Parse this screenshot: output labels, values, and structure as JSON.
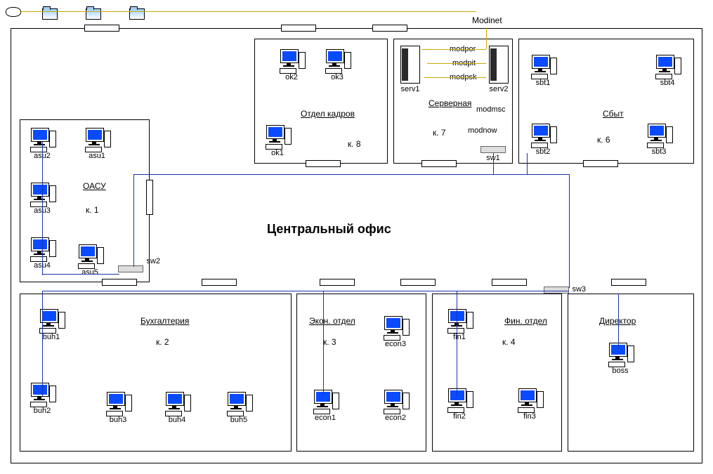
{
  "title": "Центральный офис",
  "modinet_label": "Modinet",
  "rooms": {
    "oasu": {
      "title": "ОАСУ",
      "room": "к. 1"
    },
    "buh": {
      "title": "Бухгалтерия",
      "room": "к. 2"
    },
    "econ": {
      "title": "Экон. отдел",
      "room": "к. 3"
    },
    "fin": {
      "title": "Фин. отдел",
      "room": "к. 4"
    },
    "dir": {
      "title": "Директор"
    },
    "hr": {
      "title": "Отдел кадров",
      "room": "к. 8"
    },
    "srvr": {
      "title": "Серверная",
      "room": "к. 7"
    },
    "sbyt": {
      "title": "Сбыт",
      "room": "к. 6"
    }
  },
  "pcs": {
    "asu1": "asu1",
    "asu2": "asu2",
    "asu3": "asu3",
    "asu4": "asu4",
    "asu5": "asu5",
    "buh1": "buh1",
    "buh2": "buh2",
    "buh3": "buh3",
    "buh4": "buh4",
    "buh5": "buh5",
    "econ1": "econ1",
    "econ2": "econ2",
    "econ3": "econ3",
    "fin1": "fin1",
    "fin2": "fin2",
    "fin3": "fin3",
    "boss": "boss",
    "ok1": "ok1",
    "ok2": "ok2",
    "ok3": "ok3",
    "sbt1": "sbt1",
    "sbt2": "sbt2",
    "sbt3": "sbt3",
    "sbt4": "sbt4"
  },
  "servers": {
    "serv1": "serv1",
    "serv2": "serv2"
  },
  "switches": {
    "sw1": "sw1",
    "sw2": "sw2",
    "sw3": "sw3"
  },
  "modems": {
    "modpor": "modpor",
    "modpit": "modpit",
    "modpsk": "modpsk",
    "modmsc": "modmsc",
    "modnow": "modnow"
  }
}
